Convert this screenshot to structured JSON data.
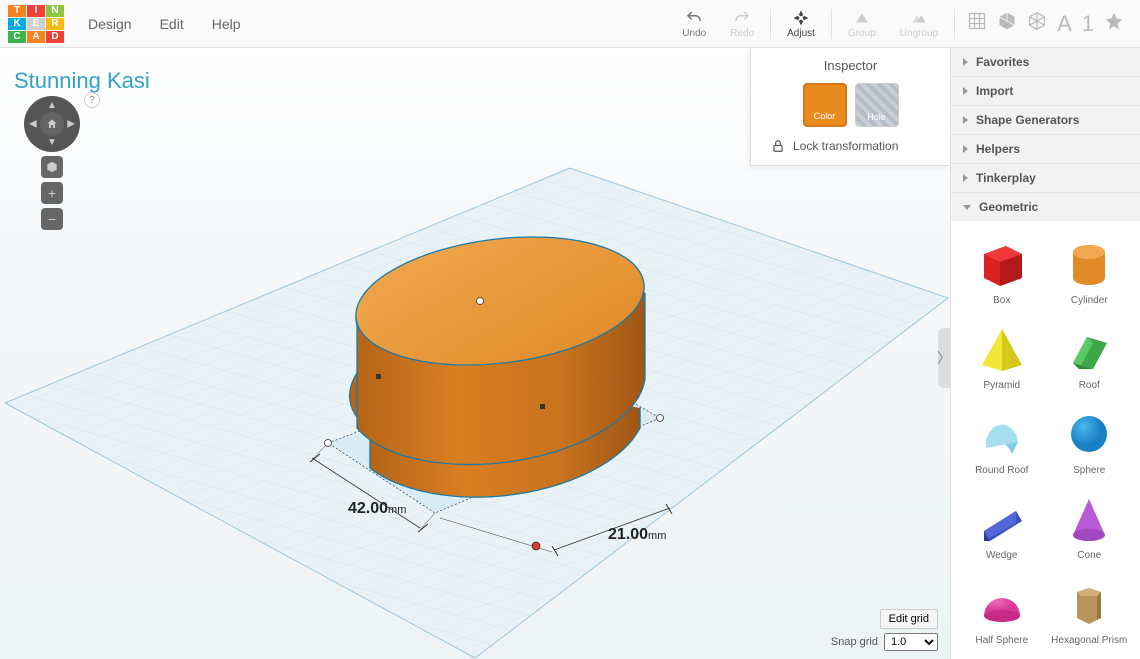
{
  "menu": {
    "design": "Design",
    "edit": "Edit",
    "help": "Help"
  },
  "toolbar": {
    "undo": "Undo",
    "redo": "Redo",
    "adjust": "Adjust",
    "group": "Group",
    "ungroup": "Ungroup"
  },
  "view_toolbar": {
    "letter": "A",
    "number": "1"
  },
  "project": {
    "title": "Stunning Kasi"
  },
  "dimensions": {
    "width_value": "42.00",
    "width_unit": "mm",
    "depth_value": "21.00",
    "depth_unit": "mm"
  },
  "inspector": {
    "title": "Inspector",
    "color_label": "Color",
    "hole_label": "Hole",
    "lock_label": "Lock transformation",
    "help": "?"
  },
  "grid_controls": {
    "edit_grid": "Edit grid",
    "snap_label": "Snap grid",
    "snap_value": "1.0"
  },
  "sidebar": {
    "panels": {
      "favorites": "Favorites",
      "import": "Import",
      "shape_generators": "Shape Generators",
      "helpers": "Helpers",
      "tinkerplay": "Tinkerplay",
      "geometric": "Geometric"
    },
    "shapes": {
      "box": "Box",
      "cylinder": "Cylinder",
      "pyramid": "Pyramid",
      "roof": "Roof",
      "round_roof": "Round Roof",
      "sphere": "Sphere",
      "wedge": "Wedge",
      "cone": "Cone",
      "half_sphere": "Half Sphere",
      "hex_prism": "Hexagonal Prism"
    }
  },
  "nav": {
    "help": "?",
    "plus": "+",
    "minus": "−"
  },
  "logo_letters": [
    "T",
    "I",
    "N",
    "K",
    "E",
    "R",
    "C",
    "A",
    "D"
  ],
  "logo_colors": [
    "#f58220",
    "#ef4136",
    "#8cc63f",
    "#00a9e0",
    "#b2b2b2",
    "#fdb913",
    "#39b54a",
    "#f58220",
    "#ef4136"
  ]
}
